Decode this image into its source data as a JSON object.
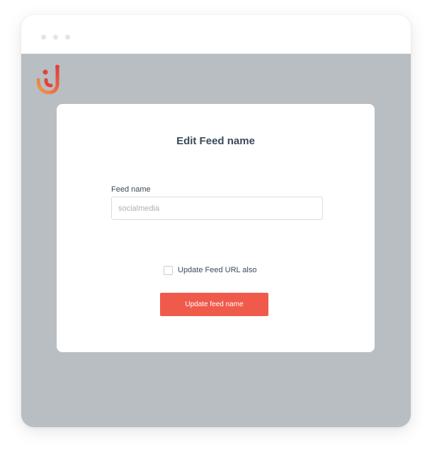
{
  "modal": {
    "title": "Edit Feed name",
    "field": {
      "label": "Feed name",
      "value": "",
      "placeholder": "socialmedia"
    },
    "checkbox": {
      "label": "Update Feed URL also",
      "checked": false
    },
    "primary_button_label": "Update feed name"
  },
  "icons": {
    "logo": "brand-logo-icon",
    "window_controls": [
      "window-dot",
      "window-dot",
      "window-dot"
    ]
  },
  "colors": {
    "primary_button": "#f05a4b",
    "backdrop": "#b8bec2",
    "title_text": "#3b4a5a",
    "logo_red": "#e0433a",
    "logo_orange": "#f2994a"
  }
}
